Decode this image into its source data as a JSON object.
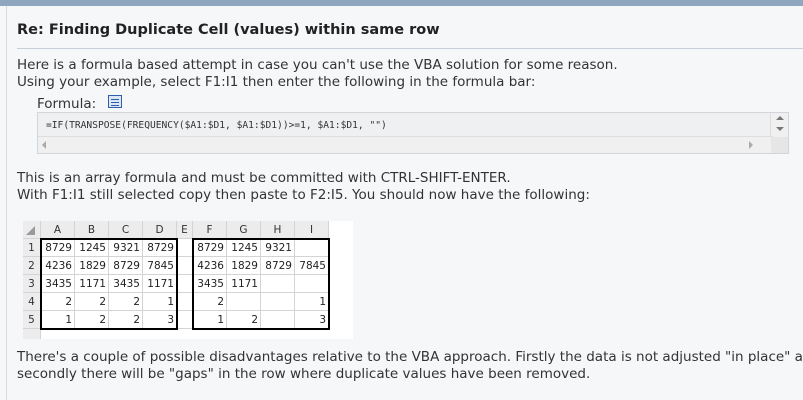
{
  "post": {
    "title": "Re: Finding Duplicate Cell (values) within same row",
    "intro_line1": "Here is a formula based attempt in case you can't use the VBA solution for some reason.",
    "intro_line2": "Using your example, select F1:I1 then enter the following in the formula bar:",
    "formula_label": "Formula:",
    "formula_code": "=IF(TRANSPOSE(FREQUENCY($A1:$D1, $A1:$D1))>=1, $A1:$D1, \"\")",
    "array_line1": "This is an array formula and must be committed with CTRL-SHIFT-ENTER.",
    "array_line2": "With F1:I1 still selected copy then paste to F2:I5. You should now have the following:",
    "outro_line1": "There's a couple of possible disadvantages relative to the VBA approach. Firstly the data is not adjusted \"in place\" and",
    "outro_line2": "secondly there will be \"gaps\" in the row where duplicate values have been removed."
  },
  "sheet": {
    "columns": [
      "A",
      "B",
      "C",
      "D",
      "E",
      "F",
      "G",
      "H",
      "I"
    ],
    "rows": [
      {
        "label": "1",
        "cells": [
          "8729",
          "1245",
          "9321",
          "8729",
          "",
          "8729",
          "1245",
          "9321",
          ""
        ]
      },
      {
        "label": "2",
        "cells": [
          "4236",
          "1829",
          "8729",
          "7845",
          "",
          "4236",
          "1829",
          "8729",
          "7845"
        ]
      },
      {
        "label": "3",
        "cells": [
          "3435",
          "1171",
          "3435",
          "1171",
          "",
          "3435",
          "1171",
          "",
          ""
        ]
      },
      {
        "label": "4",
        "cells": [
          "2",
          "2",
          "2",
          "1",
          "",
          "2",
          "",
          "",
          "1"
        ]
      },
      {
        "label": "5",
        "cells": [
          "1",
          "2",
          "2",
          "3",
          "",
          "1",
          "2",
          "",
          "3"
        ]
      }
    ]
  },
  "icons": {
    "formula_icon": "table-icon"
  }
}
